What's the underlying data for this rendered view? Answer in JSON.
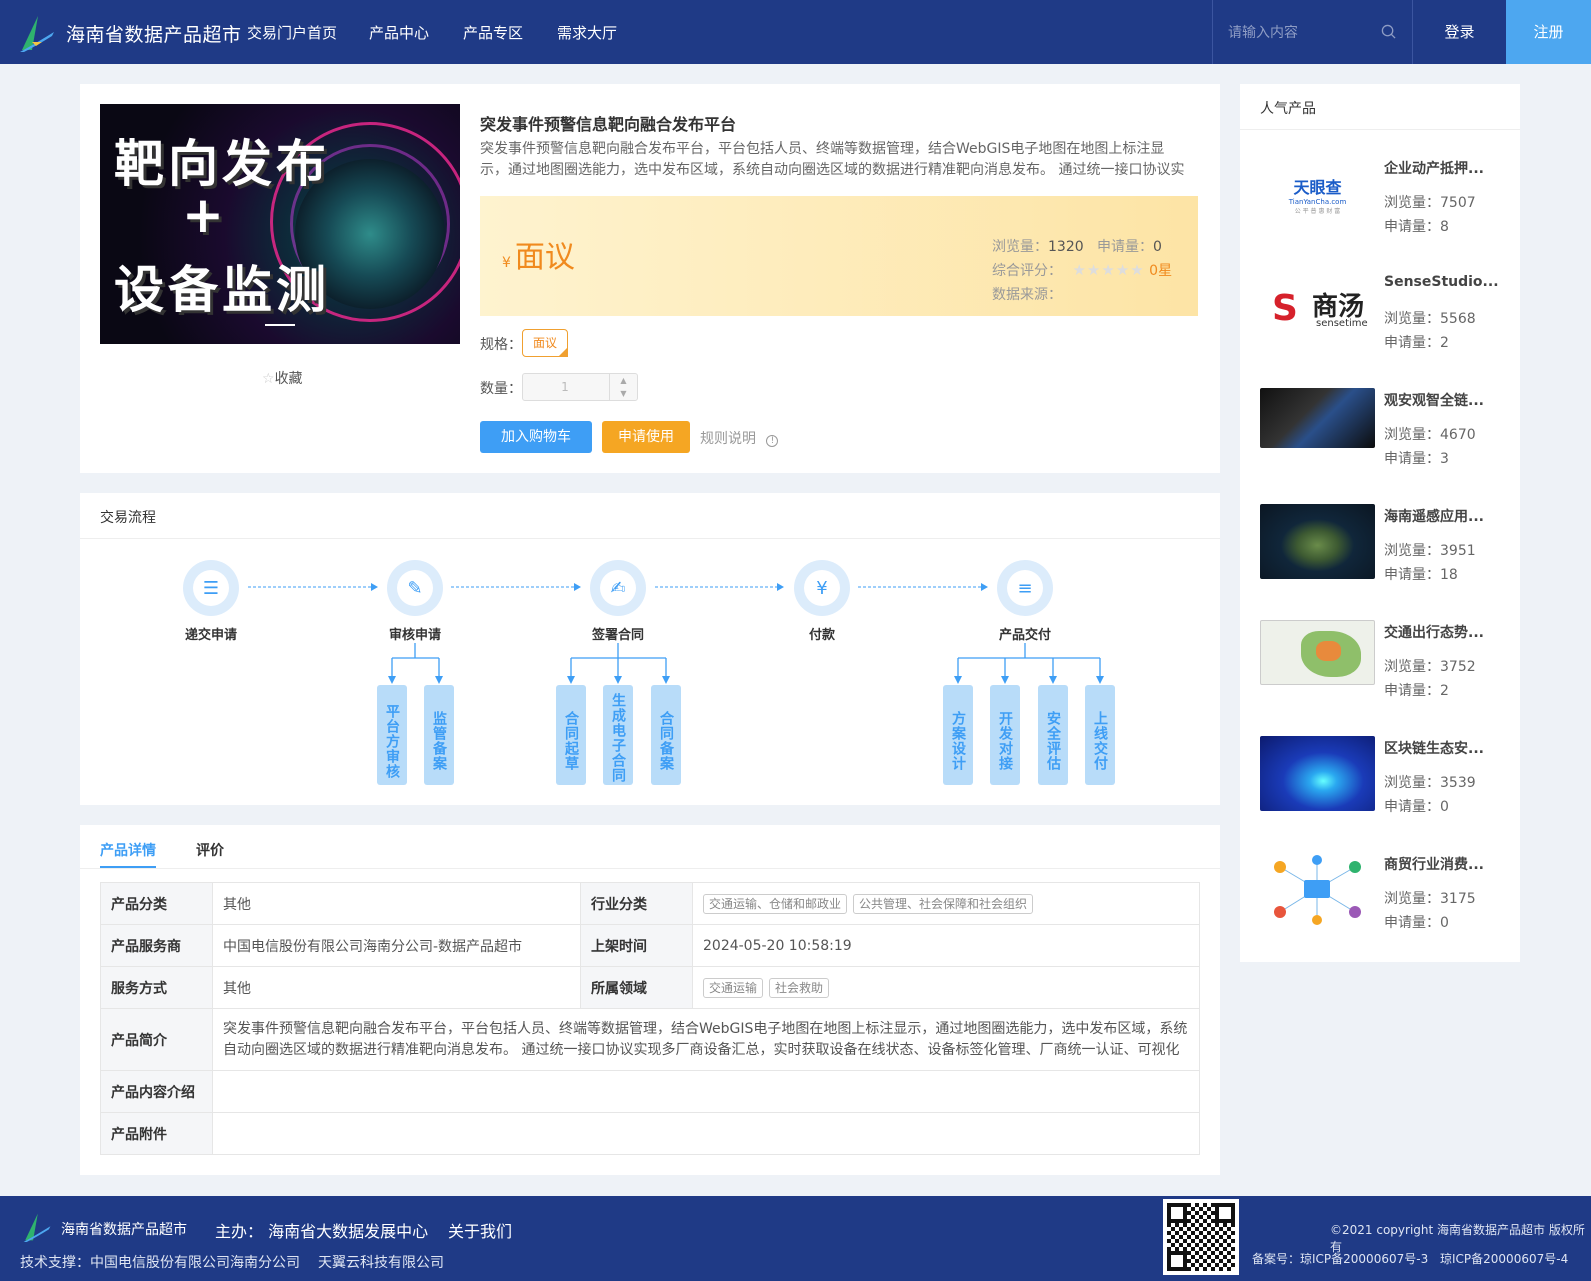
{
  "header": {
    "site_title": "海南省数据产品超市",
    "nav": [
      "交易门户首页",
      "产品中心",
      "产品专区",
      "需求大厅"
    ],
    "search_placeholder": "请输入内容",
    "login": "登录",
    "register": "注册"
  },
  "product": {
    "image_title_line1": "靶向发布",
    "image_title_plus": "+",
    "image_title_line2": "设备监测",
    "favorite": "收藏",
    "title": "突发事件预警信息靶向融合发布平台",
    "description": "突发事件预警信息靶向融合发布平台，平台包括人员、终端等数据管理，结合WebGIS电子地图在地图上标注显示，通过地图圈选能力，选中发布区域，系统自动向圈选区域的数据进行精准靶向消息发布。 通过统一接口协议实现…",
    "currency": "¥",
    "price": "面议",
    "views_label": "浏览量：",
    "views": "1320",
    "applications_label": "申请量：",
    "applications": "0",
    "rating_label": "综合评分：",
    "rating": "0星",
    "rating_value": 0,
    "source_label": "数据来源：",
    "spec_label": "规格：",
    "spec_value": "面议",
    "qty_label": "数量：",
    "qty_value": "1",
    "btn_cart": "加入购物车",
    "btn_apply": "申请使用",
    "rules": "规则说明"
  },
  "flow": {
    "title": "交易流程",
    "steps": [
      "递交申请",
      "审核申请",
      "签署合同",
      "付款",
      "产品交付"
    ],
    "sub_review": [
      "平台方审核",
      "监管备案"
    ],
    "sub_contract": [
      "合同起草",
      "生成电子合同",
      "合同备案"
    ],
    "sub_delivery": [
      "方案设计",
      "开发对接",
      "安全评估",
      "上线交付"
    ]
  },
  "tabs": [
    "产品详情",
    "评价"
  ],
  "details": {
    "category_label": "产品分类",
    "category": "其他",
    "industry_label": "行业分类",
    "industry_tags": [
      "交通运输、仓储和邮政业",
      "公共管理、社会保障和社会组织"
    ],
    "provider_label": "产品服务商",
    "provider": "中国电信股份有限公司海南分公司-数据产品超市",
    "listed_label": "上架时间",
    "listed": "2024-05-20 10:58:19",
    "service_label": "服务方式",
    "service": "其他",
    "domain_label": "所属领域",
    "domain_tags": [
      "交通运输",
      "社会救助"
    ],
    "intro_label": "产品简介",
    "intro": "突发事件预警信息靶向融合发布平台，平台包括人员、终端等数据管理，结合WebGIS电子地图在地图上标注显示，通过地图圈选能力，选中发布区域，系统自动向圈选区域的数据进行精准靶向消息发布。 通过统一接口协议实现多厂商设备汇总，实时获取设备在线状态、设备标签化管理、厂商统一认证、可视化",
    "content_label": "产品内容介绍",
    "attach_label": "产品附件"
  },
  "sidebar": {
    "title": "人气产品",
    "views_label": "浏览量：",
    "applications_label": "申请量：",
    "items": [
      {
        "name": "企业动产抵押...",
        "views": "7507",
        "applications": "8"
      },
      {
        "name": "SenseStudio...",
        "views": "5568",
        "applications": "2"
      },
      {
        "name": "观安观智全链...",
        "views": "4670",
        "applications": "3"
      },
      {
        "name": "海南遥感应用...",
        "views": "3951",
        "applications": "18"
      },
      {
        "name": "交通出行态势...",
        "views": "3752",
        "applications": "2"
      },
      {
        "name": "区块链生态安...",
        "views": "3539",
        "applications": "0"
      },
      {
        "name": "商贸行业消费...",
        "views": "3175",
        "applications": "0"
      }
    ],
    "tianyancha_logo": "天眼查",
    "tianyancha_url": "TianYanCha.com",
    "tianyancha_slogan": "公 平 普 惠 财 富",
    "sensetime_logo": "商汤",
    "sensetime_sub": "sensetime"
  },
  "footer": {
    "site_title": "海南省数据产品超市",
    "host_label": "主办：",
    "host": "海南省大数据发展中心",
    "about": "关于我们",
    "support": "技术支撑：中国电信股份有限公司海南分公司",
    "support2": "天翼云科技有限公司",
    "copyright": "©2021 copyright 海南省数据产品超市 版权所有",
    "icp1": "备案号：琼ICP备20000607号-3",
    "icp2": "琼ICP备20000607号-4"
  },
  "colors": {
    "header_bg": "#1f3a86",
    "accent_blue": "#3e9ef5",
    "accent_orange": "#f5a623",
    "price": "#f08a1e"
  }
}
